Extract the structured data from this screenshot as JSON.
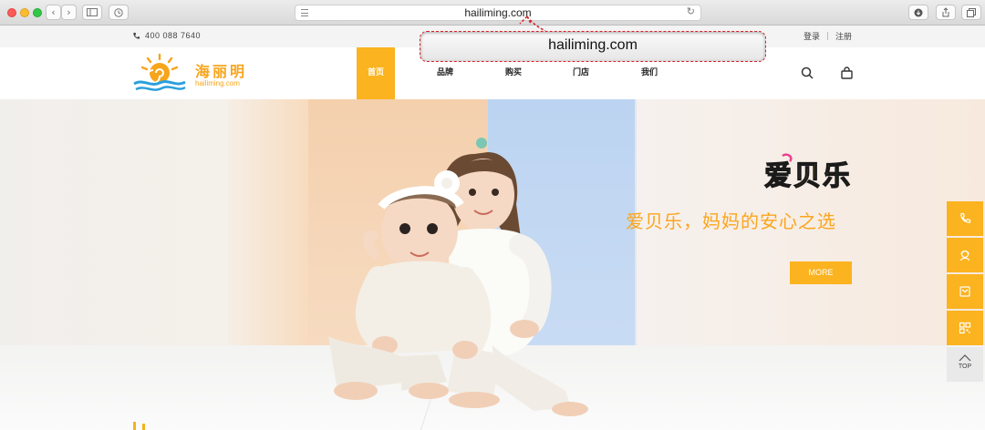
{
  "browser": {
    "url": "hailiming.com"
  },
  "topbar": {
    "phone": "400 088 7640",
    "login": "登录",
    "register": "注册"
  },
  "nav": {
    "logo_cn": "海丽明",
    "logo_en": "hailiming.com",
    "items": [
      "首页",
      "品牌",
      "购买",
      "门店",
      "我们"
    ],
    "active_index": 0
  },
  "url_overlay": {
    "text": "hailiming.com"
  },
  "hero": {
    "brand_logo_text": "爱贝乐",
    "slogan": "爱贝乐，妈妈的安心之选",
    "more_button": "MORE"
  },
  "side_toolbar": {
    "items": [
      "phone-icon",
      "service-icon",
      "message-icon",
      "qrcode-icon"
    ],
    "top_label": "TOP"
  },
  "colors": {
    "accent": "#fbb31f",
    "slogan": "#fba51c",
    "overlay_border": "#d6202a"
  }
}
